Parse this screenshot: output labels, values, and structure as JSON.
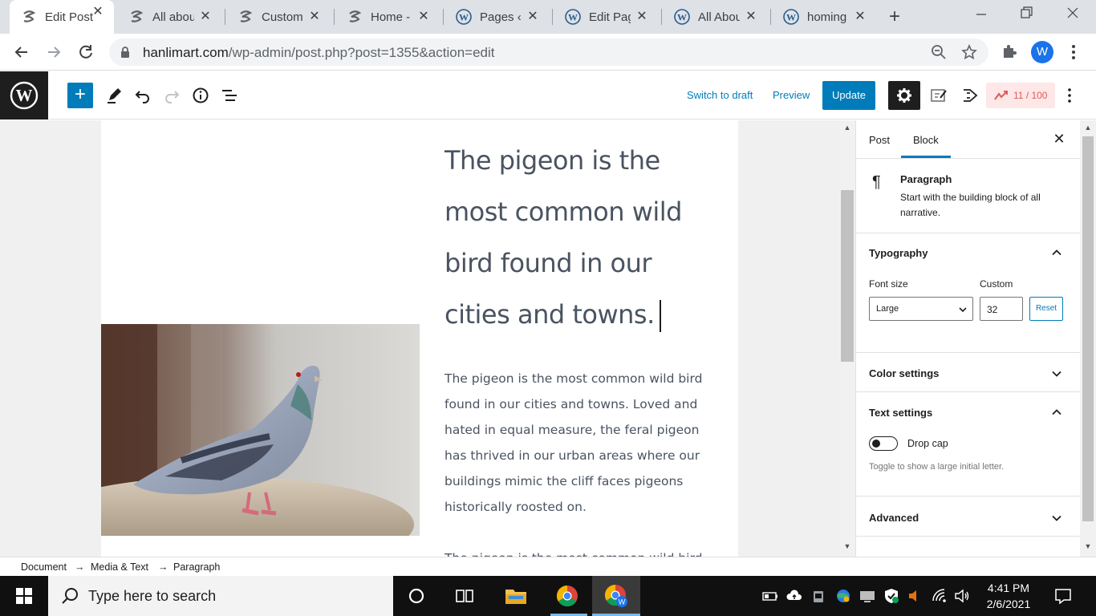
{
  "browser": {
    "tabs": [
      {
        "title": "Edit Post",
        "icon": "wp-mini-icon",
        "active": true
      },
      {
        "title": "All about",
        "icon": "wp-mini-icon"
      },
      {
        "title": "Customi",
        "icon": "wp-mini-icon"
      },
      {
        "title": "Home -",
        "icon": "wp-mini-icon"
      },
      {
        "title": "Pages ‹ I",
        "icon": "wordpress-icon"
      },
      {
        "title": "Edit Pag",
        "icon": "wordpress-icon"
      },
      {
        "title": "All Abou",
        "icon": "wordpress-icon"
      },
      {
        "title": "homing",
        "icon": "wordpress-icon"
      }
    ],
    "url_host": "hanlimart.com",
    "url_path": "/wp-admin/post.php?post=1355&action=edit",
    "profile_initial": "W"
  },
  "editor": {
    "switch_to_draft": "Switch to draft",
    "preview": "Preview",
    "update": "Update",
    "score": "11 / 100"
  },
  "content": {
    "heading": "The pigeon is the most common wild bird found in our cities and towns.",
    "paragraph": "The pigeon is the most common wild bird found in our cities and towns. Loved and hated in equal measure, the feral pigeon has thrived in our urban areas where our buildings mimic the cliff faces pigeons historically roosted on.",
    "paragraph_next": "The pigeon is the most common wild bird"
  },
  "sidebar": {
    "tab_post": "Post",
    "tab_block": "Block",
    "block_name": "Paragraph",
    "block_desc": "Start with the building block of all narrative.",
    "typography": "Typography",
    "font_size_label": "Font size",
    "custom_label": "Custom",
    "font_size_value": "Large",
    "custom_value": "32",
    "reset": "Reset",
    "color_settings": "Color settings",
    "text_settings": "Text settings",
    "drop_cap": "Drop cap",
    "drop_cap_help": "Toggle to show a large initial letter.",
    "advanced": "Advanced"
  },
  "breadcrumb": [
    "Document",
    "Media & Text",
    "Paragraph"
  ],
  "breadcrumb_sep": "→",
  "taskbar": {
    "search_placeholder": "Type here to search",
    "time": "4:41 PM",
    "date": "2/6/2021"
  },
  "colors": {
    "wp_blue": "#007cba",
    "score_red": "#e25b5b"
  }
}
